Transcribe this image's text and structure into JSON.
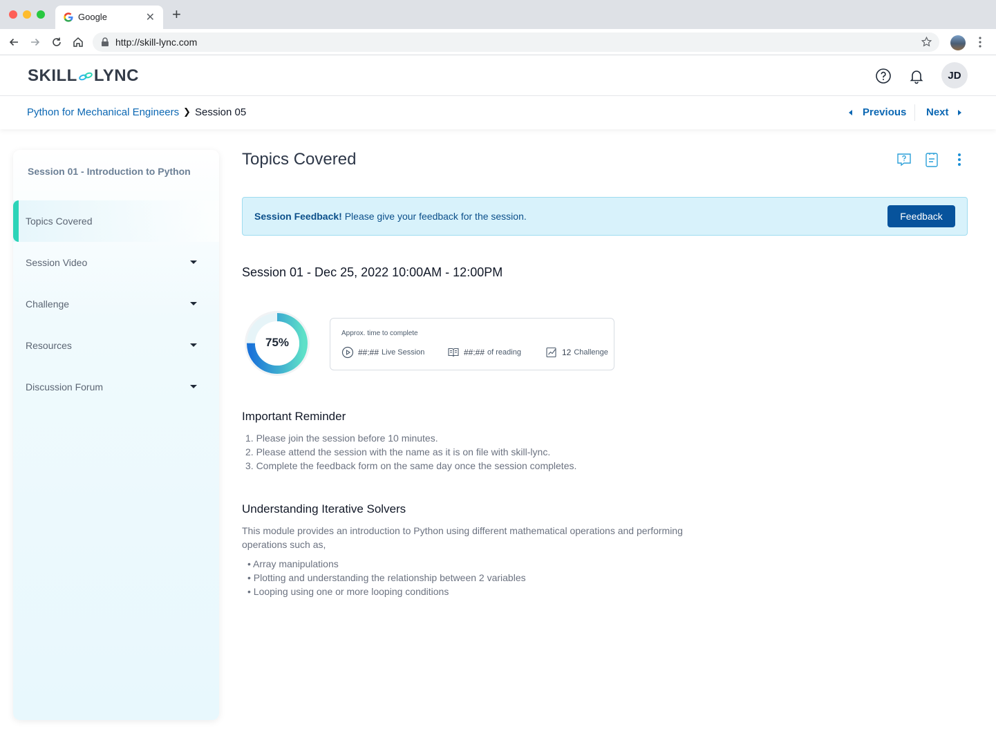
{
  "browser": {
    "tab_title": "Google",
    "url": "http://skill-lync.com"
  },
  "header": {
    "logo_left": "SKILL",
    "logo_right": "LYNC",
    "avatar_initials": "JD"
  },
  "breadcrumb": {
    "course": "Python for Mechanical Engineers",
    "current": "Session 05",
    "previous_label": "Previous",
    "next_label": "Next"
  },
  "sidebar": {
    "title": "Session 01 - Introduction to Python",
    "items": [
      {
        "label": "Topics Covered",
        "active": true,
        "expandable": false
      },
      {
        "label": "Session Video",
        "active": false,
        "expandable": true
      },
      {
        "label": "Challenge",
        "active": false,
        "expandable": true
      },
      {
        "label": "Resources",
        "active": false,
        "expandable": true
      },
      {
        "label": "Discussion Forum",
        "active": false,
        "expandable": true
      }
    ]
  },
  "main": {
    "title": "Topics Covered",
    "banner": {
      "bold": "Session Feedback!",
      "text": " Please give your feedback for the session.",
      "button_label": "Feedback"
    },
    "session_heading": "Session 01 - Dec 25, 2022  10:00AM - 12:00PM",
    "progress": {
      "value": 0.75,
      "label": "75%"
    },
    "time_card": {
      "label": "Approx. time to complete",
      "stats": [
        {
          "value": "##:##",
          "unit": "Live Session",
          "icon": "play-circle-icon"
        },
        {
          "value": "##:##",
          "unit": "of reading",
          "icon": "book-icon"
        },
        {
          "value": "12",
          "unit": "Challenge",
          "icon": "chart-icon"
        }
      ]
    },
    "reminder": {
      "heading": "Important Reminder",
      "items": [
        "1. Please join the session before 10 minutes.",
        "2. Please attend the session with the name as it is on file with skill-lync.",
        "3. Complete the feedback form on the same day once the session completes."
      ]
    },
    "solvers": {
      "heading": "Understanding Iterative Solvers",
      "paragraph_line1": "This module provides an introduction to Python using different mathematical operations and performing",
      "paragraph_line2": "operations such as,",
      "bullets": [
        "•  Array manipulations",
        "•  Plotting and understanding the relationship between 2 variables",
        "•  Looping using one or more looping conditions"
      ]
    }
  },
  "colors": {
    "brand_blue": "#0b67b3",
    "button_blue": "#07539c",
    "active_accent": "#2cd4b8",
    "banner_bg": "#d8f2fb"
  }
}
